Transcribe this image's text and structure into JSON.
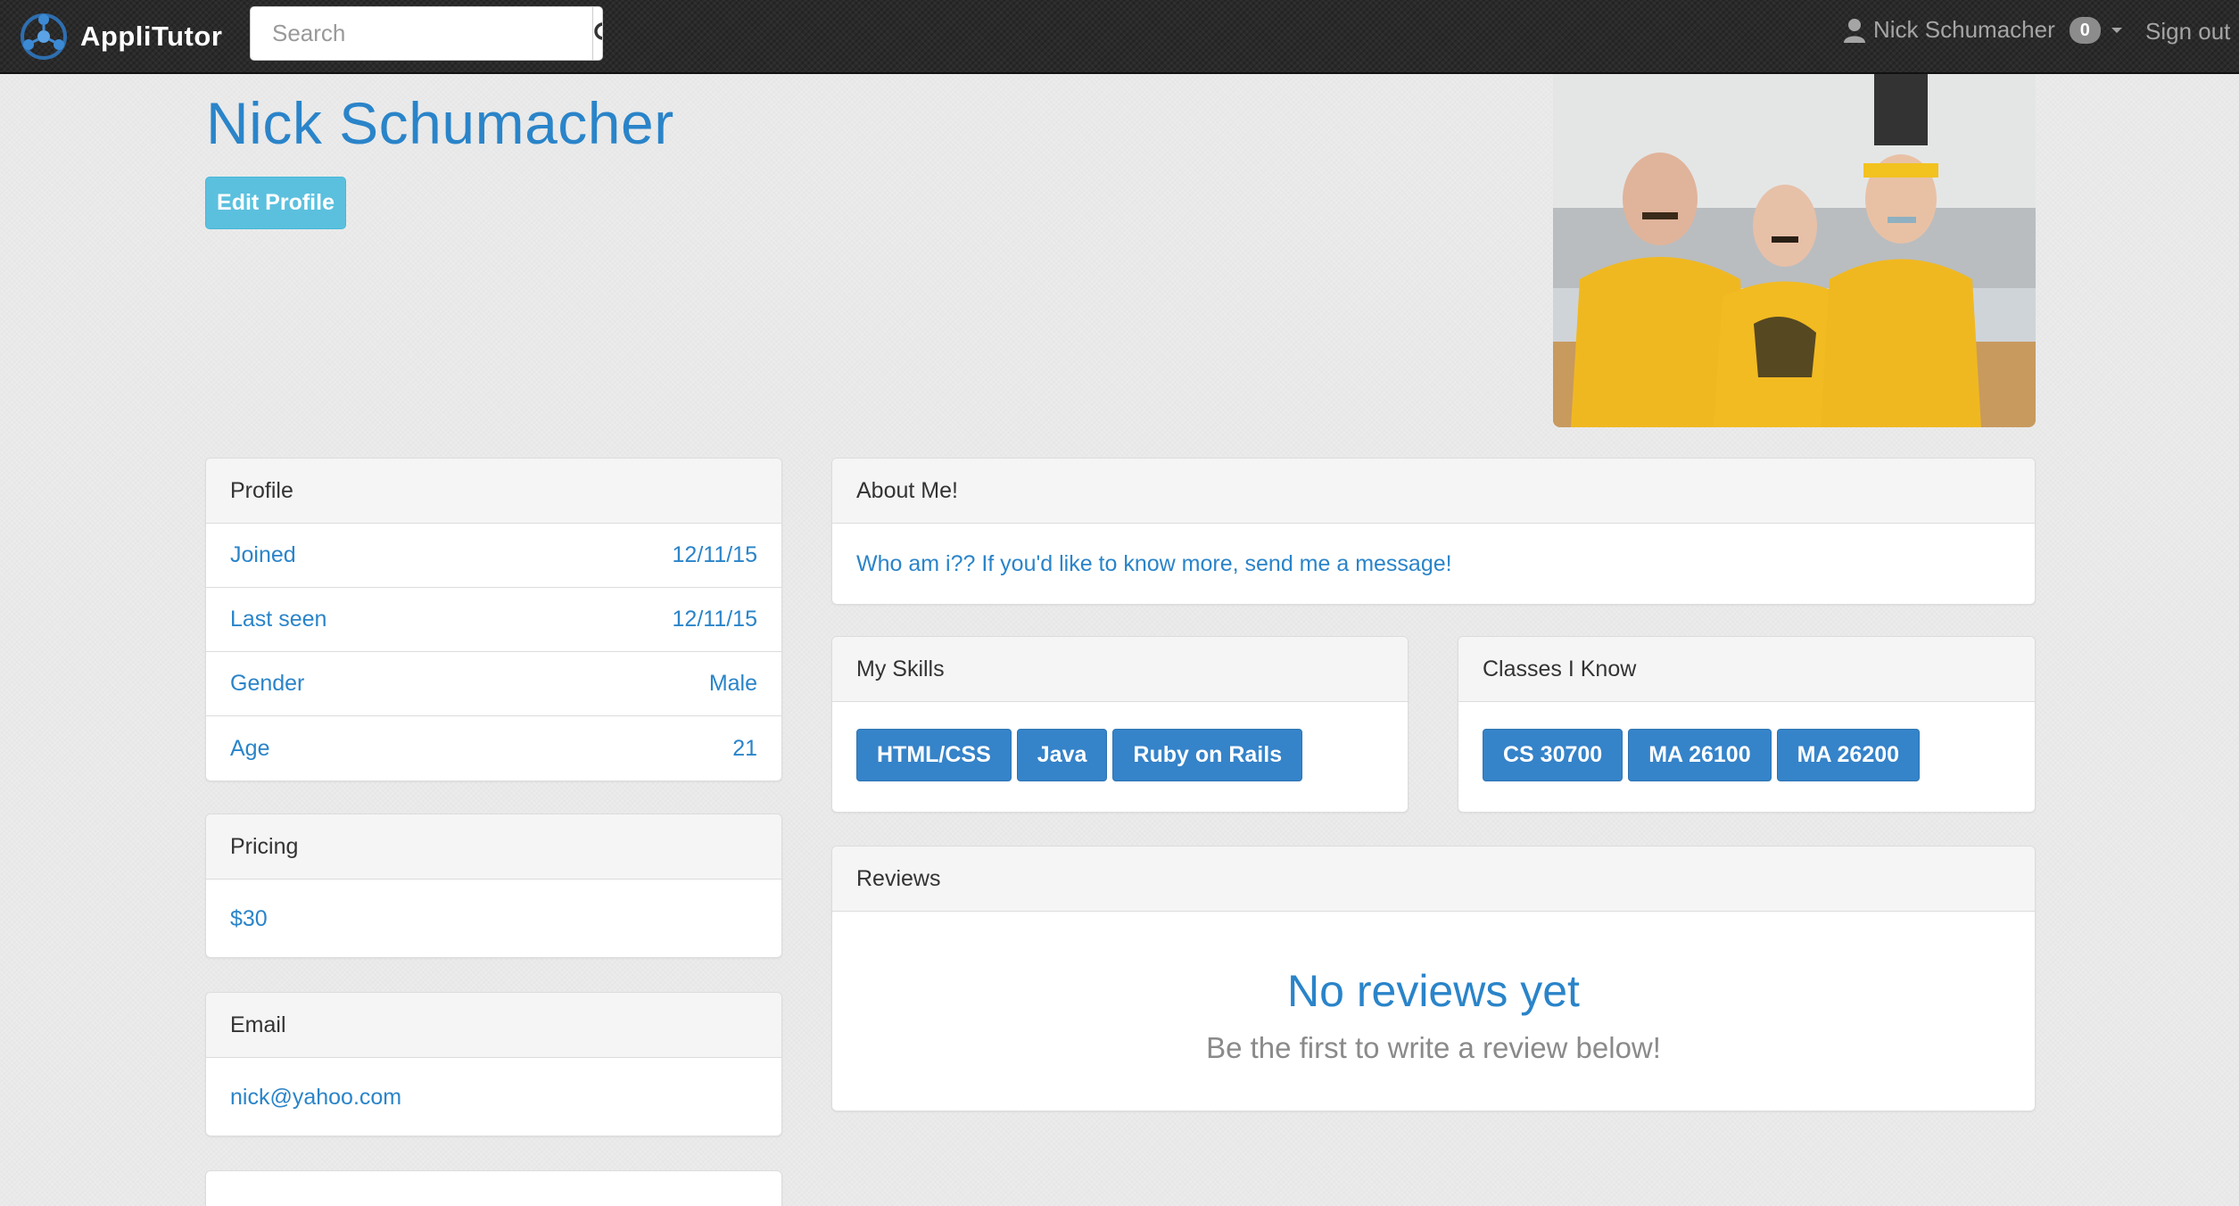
{
  "navbar": {
    "brand": "AppliTutor",
    "search_placeholder": "Search",
    "user_name": "Nick Schumacher",
    "notification_count": "0",
    "sign_out": "Sign out"
  },
  "profile": {
    "name": "Nick Schumacher",
    "edit_label": "Edit Profile"
  },
  "profile_panel": {
    "title": "Profile",
    "rows": [
      {
        "label": "Joined",
        "value": "12/11/15"
      },
      {
        "label": "Last seen",
        "value": "12/11/15"
      },
      {
        "label": "Gender",
        "value": "Male"
      },
      {
        "label": "Age",
        "value": "21"
      }
    ]
  },
  "pricing_panel": {
    "title": "Pricing",
    "value": "$30"
  },
  "email_panel": {
    "title": "Email",
    "value": "nick@yahoo.com"
  },
  "about_panel": {
    "title": "About Me!",
    "text": "Who am i?? If you'd like to know more, send me a message!"
  },
  "skills_panel": {
    "title": "My Skills",
    "items": [
      "HTML/CSS",
      "Java",
      "Ruby on Rails"
    ]
  },
  "classes_panel": {
    "title": "Classes I Know",
    "items": [
      "CS 30700",
      "MA 26100",
      "MA 26200"
    ]
  },
  "reviews_panel": {
    "title": "Reviews",
    "empty_title": "No reviews yet",
    "empty_subtitle": "Be the first to write a review below!"
  },
  "colors": {
    "accent": "#2a84c9",
    "info_button": "#5bc0de",
    "tag": "#3583c9"
  }
}
